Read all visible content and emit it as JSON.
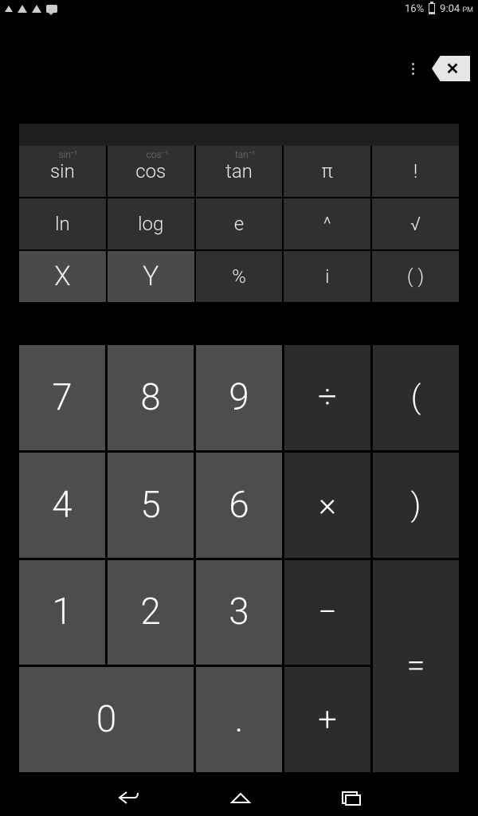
{
  "status": {
    "battery": "16%",
    "time": "9:04",
    "ampm": "PM"
  },
  "actions": {
    "delete_glyph": "✕"
  },
  "fn": {
    "r1": {
      "sin": {
        "label": "sin",
        "sup": "sin⁻¹"
      },
      "cos": {
        "label": "cos",
        "sup": "cos⁻¹"
      },
      "tan": {
        "label": "tan",
        "sup": "tan⁻¹"
      },
      "pi": {
        "label": "π"
      },
      "fact": {
        "label": "!"
      }
    },
    "r2": {
      "ln": {
        "label": "ln"
      },
      "log": {
        "label": "log"
      },
      "e": {
        "label": "e"
      },
      "pow": {
        "label": "^"
      },
      "sqrt": {
        "label": "√"
      }
    },
    "r3": {
      "x": {
        "label": "X"
      },
      "y": {
        "label": "Y"
      },
      "pct": {
        "label": "%"
      },
      "i": {
        "label": "i"
      },
      "paren": {
        "label": "( )"
      }
    }
  },
  "keys": {
    "n7": "7",
    "n8": "8",
    "n9": "9",
    "div": "÷",
    "lpar": "(",
    "n4": "4",
    "n5": "5",
    "n6": "6",
    "mul": "×",
    "rpar": ")",
    "n1": "1",
    "n2": "2",
    "n3": "3",
    "sub": "−",
    "n0": "0",
    "dot": ".",
    "add": "+",
    "eq": "="
  }
}
